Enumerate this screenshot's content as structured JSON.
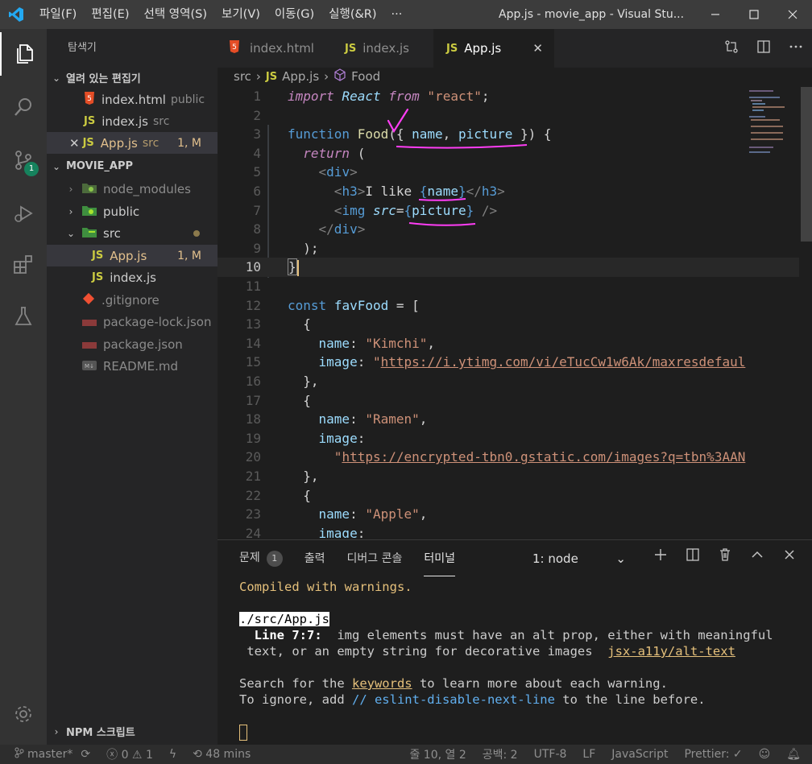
{
  "titlebar": {
    "menu": [
      "파일(F)",
      "편집(E)",
      "선택 영역(S)",
      "보기(V)",
      "이동(G)",
      "실행(&R)",
      "···"
    ],
    "window_title": "App.js - movie_app - Visual Stu..."
  },
  "activity": {
    "scm_badge": "1"
  },
  "sidebar": {
    "header": "탐색기",
    "open_editors_label": "열려 있는 편집기",
    "open_editors": [
      {
        "name": "index.html",
        "dir": "public"
      },
      {
        "name": "index.js",
        "dir": "src"
      },
      {
        "name": "App.js",
        "dir": "src",
        "status": "1, M"
      }
    ],
    "project_label": "MOVIE_APP",
    "tree": {
      "node_modules": "node_modules",
      "public": "public",
      "src": "src",
      "app_js": "App.js",
      "app_js_status": "1, M",
      "index_js": "index.js",
      "gitignore": ".gitignore",
      "package_lock": "package-lock.json",
      "package_json": "package.json",
      "readme": "README.md"
    },
    "npm_label": "NPM 스크립트"
  },
  "tabs": [
    {
      "label": "index.html",
      "icon": "html5-icon"
    },
    {
      "label": "index.js",
      "icon": "js-icon"
    },
    {
      "label": "App.js",
      "icon": "js-icon",
      "active": true
    }
  ],
  "breadcrumb": {
    "folder": "src",
    "file": "App.js",
    "symbol": "Food"
  },
  "code": {
    "line_numbers": [
      "1",
      "2",
      "3",
      "4",
      "5",
      "6",
      "7",
      "8",
      "9",
      "10",
      "11",
      "12",
      "13",
      "14",
      "15",
      "16",
      "17",
      "18",
      "19",
      "20",
      "21",
      "22",
      "23",
      "24"
    ],
    "strings": {
      "react": "\"react\"",
      "kimchi": "\"Kimchi\"",
      "kimchi_url": "https://i.ytimg.com/vi/eTucCw1w6Ak/maxresdefaul",
      "ramen": "\"Ramen\"",
      "ramen_url": "https://encrypted-tbn0.gstatic.com/images?q=tbn%3AAN",
      "apple": "\"Apple\""
    }
  },
  "panel": {
    "tabs": [
      "문제",
      "출력",
      "디버그 콘솔",
      "터미널"
    ],
    "problems_count": "1",
    "terminal_select": "1: node",
    "lines": {
      "compiled": "Compiled with warnings.",
      "file": "./src/App.js",
      "line_label": "Line 7:7:",
      "msg1": "  img elements must have an alt prop, either with meaningful",
      "msg2": " text, or an empty string for decorative images  ",
      "rule": "jsx-a11y/alt-text",
      "search_pre": "Search for the ",
      "keywords": "keywords",
      "search_post": " to learn more about each warning.",
      "ignore_pre": "To ignore, add ",
      "ignore_code": "// eslint-disable-next-line",
      "ignore_post": " to the line before."
    }
  },
  "status": {
    "branch": "master*",
    "errors": "0",
    "warnings": "1",
    "time": "48 mins",
    "position": "줄 10, 열 2",
    "spaces": "공백: 2",
    "encoding": "UTF-8",
    "eol": "LF",
    "language": "JavaScript",
    "prettier": "Prettier:"
  },
  "colors": {
    "accent_blue": "#007acc",
    "badge_green": "#16825d",
    "annotation_pink": "#ff3df5",
    "warning_yellow": "#e5c07b"
  }
}
